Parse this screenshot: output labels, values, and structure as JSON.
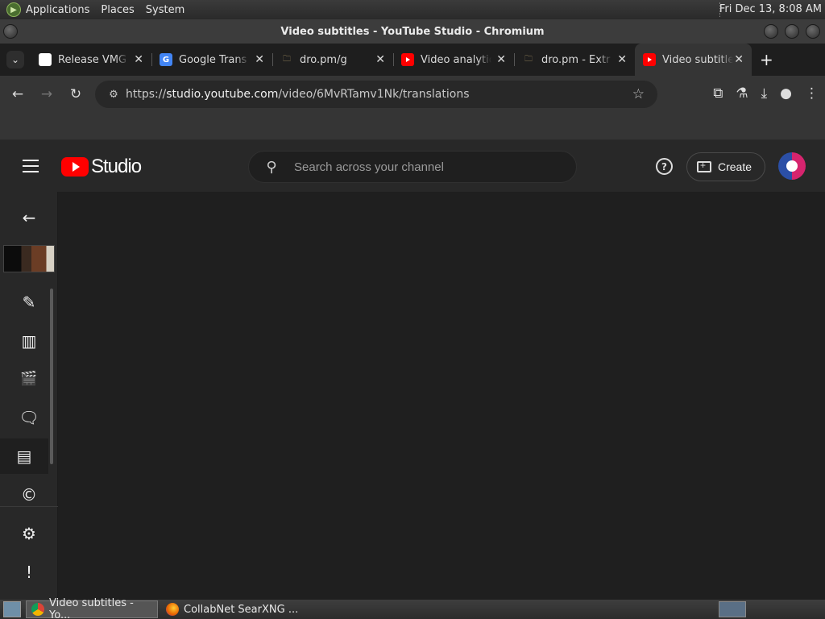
{
  "top_panel": {
    "menus": [
      "Applications",
      "Places",
      "System"
    ],
    "clock": "Fri Dec 13,  8:08 AM"
  },
  "window": {
    "title": "Video subtitles - YouTube Studio - Chromium"
  },
  "tabs": [
    {
      "label": "Release VMG",
      "icon": "github-icon"
    },
    {
      "label": "Google Trans",
      "icon": "google-translate-icon"
    },
    {
      "label": "dro.pm/g",
      "icon": "folder-icon"
    },
    {
      "label": "Video analytic",
      "icon": "youtube-icon"
    },
    {
      "label": "dro.pm - Extr",
      "icon": "folder-icon"
    },
    {
      "label": "Video subtitle",
      "icon": "youtube-icon",
      "active": true
    }
  ],
  "address_bar": {
    "url_prefix": "https://",
    "url_host": "studio.youtube.com",
    "url_path": "/video/6MvRTamv1Nk/translations"
  },
  "yt_header": {
    "logo_text": "Studio",
    "search_placeholder": "Search across your channel",
    "create_label": "Create",
    "help_glyph": "?"
  },
  "rail": {
    "items": [
      {
        "name": "back-arrow-icon",
        "glyph": "←"
      },
      {
        "name": "edit-pencil-icon",
        "glyph": "✎"
      },
      {
        "name": "analytics-icon",
        "glyph": "▥"
      },
      {
        "name": "editor-clapper-icon",
        "glyph": "🎬"
      },
      {
        "name": "comments-icon",
        "glyph": "🗨"
      },
      {
        "name": "subtitles-icon",
        "glyph": "▤"
      },
      {
        "name": "copyright-icon",
        "glyph": "©"
      },
      {
        "name": "settings-gear-icon",
        "glyph": "⚙"
      },
      {
        "name": "feedback-icon",
        "glyph": "!"
      }
    ]
  },
  "taskbar": {
    "tasks": [
      {
        "label": "Video subtitles - Yo...",
        "active": true
      },
      {
        "label": "CollabNet SearXNG ...",
        "active": false
      }
    ]
  },
  "colors": {
    "youtube_red": "#ff0000",
    "page_bg": "#1f1f1f",
    "header_bg": "#282828"
  }
}
